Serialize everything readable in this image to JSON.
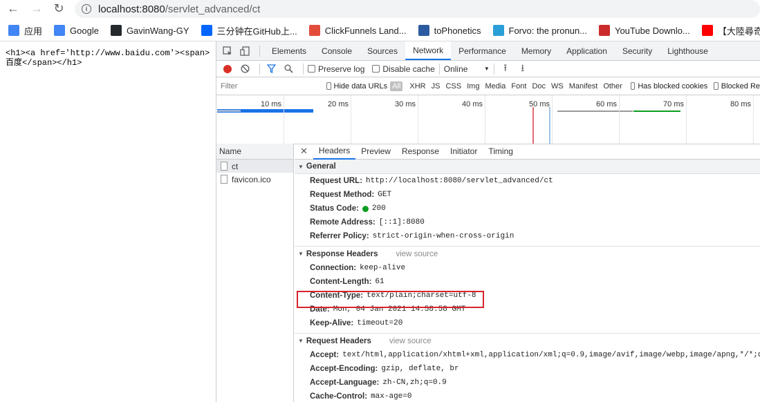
{
  "browser": {
    "url_host": "localhost:8080",
    "url_path": "/servlet_advanced/ct",
    "bookmarks": [
      {
        "label": "应用",
        "icon": "apps-grid-icon",
        "color": "#4285f4"
      },
      {
        "label": "Google",
        "icon": "google-icon",
        "color": "#4285f4"
      },
      {
        "label": "GavinWang-GY",
        "icon": "github-icon",
        "color": "#24292e"
      },
      {
        "label": "三分钟在GitHub上...",
        "icon": "zhihu-icon",
        "color": "#0066ff"
      },
      {
        "label": "ClickFunnels Land...",
        "icon": "clickfunnels-icon",
        "color": "#e34b3b"
      },
      {
        "label": "toPhonetics",
        "icon": "tophonetics-icon",
        "color": "#2c5aa0"
      },
      {
        "label": "Forvo: the pronun...",
        "icon": "forvo-icon",
        "color": "#2b9fd8"
      },
      {
        "label": "YouTube Downlo...",
        "icon": "youtube-downloader-icon",
        "color": "#cc2b2b"
      },
      {
        "label": "【大陸尋奇】",
        "icon": "youtube-icon",
        "color": "#ff0000"
      }
    ]
  },
  "page": {
    "body_text": "<h1><a href='http://www.baidu.com'><span>\n百度</span></h1>"
  },
  "devtools": {
    "tabs": [
      "Elements",
      "Console",
      "Sources",
      "Network",
      "Performance",
      "Memory",
      "Application",
      "Security",
      "Lighthouse"
    ],
    "active_tab": "Network",
    "toolbar": {
      "preserve_log": "Preserve log",
      "disable_cache": "Disable cache",
      "throttle": "Online"
    },
    "filter": {
      "placeholder": "Filter",
      "hide_data_urls": "Hide data URLs",
      "types": [
        "All",
        "XHR",
        "JS",
        "CSS",
        "Img",
        "Media",
        "Font",
        "Doc",
        "WS",
        "Manifest",
        "Other"
      ],
      "has_blocked_cookies": "Has blocked cookies",
      "blocked_requests": "Blocked Re"
    },
    "timeline_labels": [
      "10 ms",
      "20 ms",
      "30 ms",
      "40 ms",
      "50 ms",
      "60 ms",
      "70 ms",
      "80 ms"
    ],
    "names_header": "Name",
    "requests": [
      "ct",
      "favicon.ico"
    ],
    "detail_tabs": [
      "Headers",
      "Preview",
      "Response",
      "Initiator",
      "Timing"
    ],
    "general": {
      "title": "General",
      "request_url_k": "Request URL:",
      "request_url_v": "http://localhost:8080/servlet_advanced/ct",
      "method_k": "Request Method:",
      "method_v": "GET",
      "status_k": "Status Code:",
      "status_v": "200",
      "remote_k": "Remote Address:",
      "remote_v": "[::1]:8080",
      "referrer_k": "Referrer Policy:",
      "referrer_v": "strict-origin-when-cross-origin"
    },
    "response_headers": {
      "title": "Response Headers",
      "view_source": "view source",
      "rows": [
        {
          "k": "Connection:",
          "v": "keep-alive"
        },
        {
          "k": "Content-Length:",
          "v": "61"
        },
        {
          "k": "Content-Type:",
          "v": "text/plain;charset=utf-8"
        },
        {
          "k": "Date:",
          "v": "Mon, 04 Jan 2021 14:58:58 GMT"
        },
        {
          "k": "Keep-Alive:",
          "v": "timeout=20"
        }
      ]
    },
    "request_headers": {
      "title": "Request Headers",
      "view_source": "view source",
      "rows": [
        {
          "k": "Accept:",
          "v": "text/html,application/xhtml+xml,application/xml;q=0.9,image/avif,image/webp,image/apng,*/*;q=0.8,applic"
        },
        {
          "k": "Accept-Encoding:",
          "v": "gzip, deflate, br"
        },
        {
          "k": "Accept-Language:",
          "v": "zh-CN,zh;q=0.9"
        },
        {
          "k": "Cache-Control:",
          "v": "max-age=0"
        }
      ]
    },
    "highlight_color": "#d9232a"
  }
}
